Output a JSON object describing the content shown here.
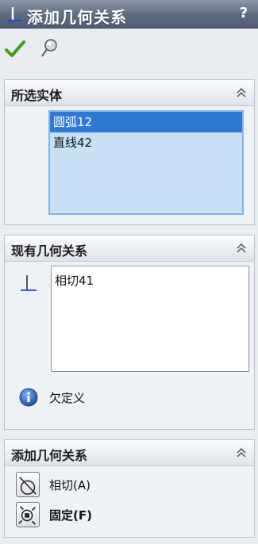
{
  "window": {
    "title": "添加几何关系",
    "help_label": "?"
  },
  "toolbar": {
    "ok_icon": "checkmark-icon",
    "pin_icon": "pushpin-icon"
  },
  "selected_entities": {
    "title": "所选实体",
    "items": [
      "圆弧12",
      "直线42"
    ],
    "selected_index": 0
  },
  "existing_relations": {
    "title": "现有几何关系",
    "items": [
      "相切41"
    ],
    "status": "欠定义"
  },
  "add_relations": {
    "title": "添加几何关系",
    "buttons": [
      {
        "label": "相切(A)",
        "icon": "tangent-relation-icon"
      },
      {
        "label": "固定(F)",
        "icon": "fix-relation-icon"
      }
    ]
  },
  "colors": {
    "title_bar": "#5e6b7f",
    "selection": "#2f78d6",
    "listbox_bg": "#c8e0f6",
    "accept_green": "#3aa012"
  }
}
